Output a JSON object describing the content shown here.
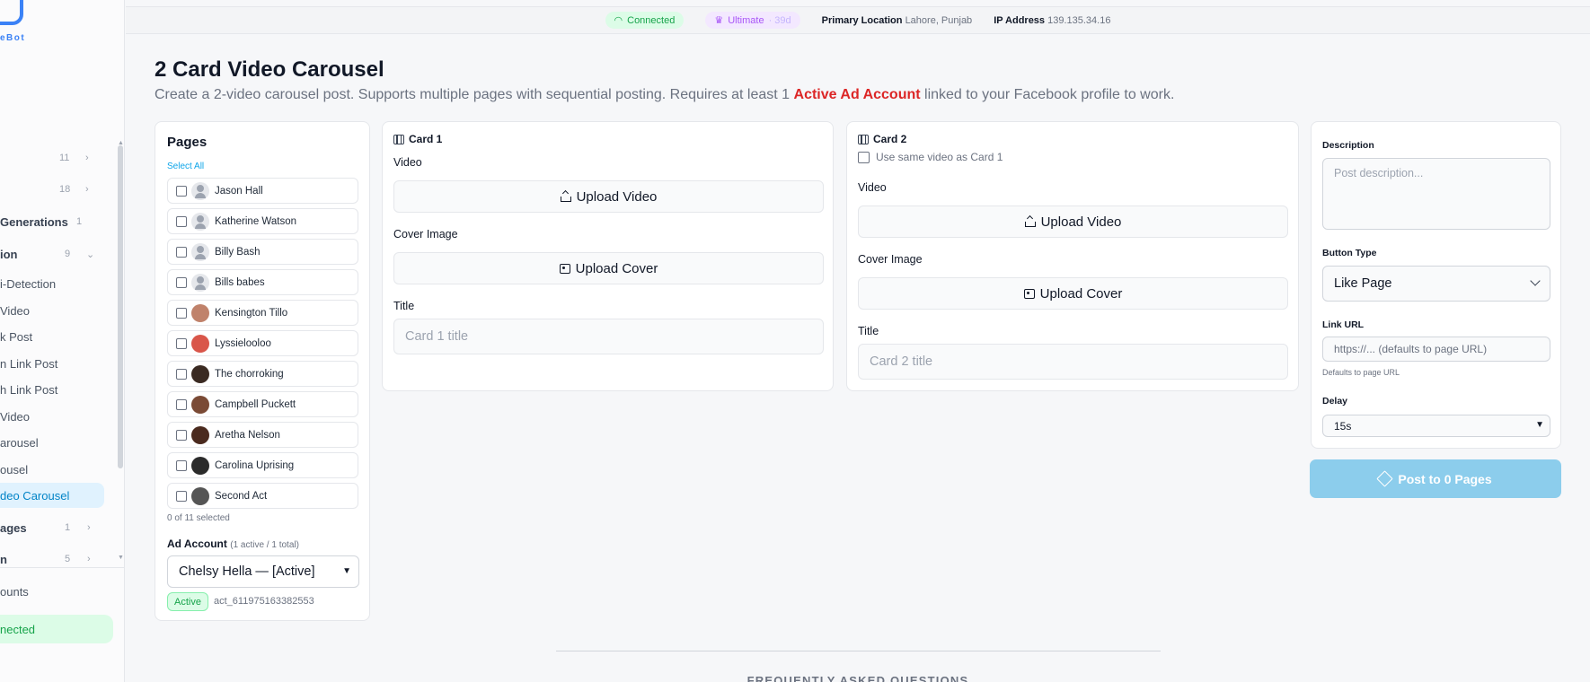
{
  "sidebar": {
    "brand": "eBot",
    "items": [
      {
        "label": "",
        "count": "11",
        "chevron": "›"
      },
      {
        "label": "",
        "count": "18",
        "chevron": "›"
      },
      {
        "label": "Generations",
        "count": "1",
        "chevron": ""
      },
      {
        "label": "ion",
        "count": "9",
        "chevron": "⌄"
      },
      {
        "label": "i-Detection",
        "count": "",
        "chevron": ""
      },
      {
        "label": "Video",
        "count": "",
        "chevron": ""
      },
      {
        "label": "k Post",
        "count": "",
        "chevron": ""
      },
      {
        "label": "n Link Post",
        "count": "",
        "chevron": ""
      },
      {
        "label": "h Link Post",
        "count": "",
        "chevron": ""
      },
      {
        "label": " Video",
        "count": "",
        "chevron": ""
      },
      {
        "label": "arousel",
        "count": "",
        "chevron": ""
      },
      {
        "label": "ousel",
        "count": "",
        "chevron": ""
      },
      {
        "label": "deo Carousel",
        "count": "",
        "chevron": ""
      },
      {
        "label": "ages",
        "count": "1",
        "chevron": "›"
      },
      {
        "label": "n",
        "count": "5",
        "chevron": "›"
      }
    ],
    "accounts_label": "ounts",
    "connected_label": "nected"
  },
  "topbar": {
    "connected": "Connected",
    "plan": "Ultimate",
    "plan_days": "· 39d",
    "location_label": "Primary Location",
    "location_value": "Lahore, Punjab",
    "ip_label": "IP Address",
    "ip_value": "139.135.34.16"
  },
  "header": {
    "title": "2 Card Video Carousel",
    "desc_before": "Create a 2-video carousel post. Supports multiple pages with sequential posting. Requires at least 1 ",
    "desc_highlight": "Active Ad Account",
    "desc_after": " linked to your Facebook profile to work."
  },
  "pages": {
    "title": "Pages",
    "select_all": "Select All",
    "items": [
      {
        "name": "Jason Hall",
        "color": "#e5e7eb"
      },
      {
        "name": "Katherine Watson",
        "color": "#e5e7eb"
      },
      {
        "name": "Billy Bash",
        "color": "#e5e7eb"
      },
      {
        "name": "Bills babes",
        "color": "#e5e7eb"
      },
      {
        "name": "Kensington Tillo",
        "color": "#c0826b"
      },
      {
        "name": "Lyssieloolоо",
        "color": "#d9564a"
      },
      {
        "name": "The chorroking",
        "color": "#3a2a22"
      },
      {
        "name": "Campbell Puckett",
        "color": "#7a4a35"
      },
      {
        "name": "Aretha Nelson",
        "color": "#4a2a1e"
      },
      {
        "name": "Carolina Uprising",
        "color": "#2b2b2b"
      },
      {
        "name": "Second Act",
        "color": "#555555"
      }
    ],
    "selected_text": "0 of 11 selected",
    "ad_account_label": "Ad Account",
    "ad_account_meta": "(1 active / 1 total)",
    "ad_account_value": "Chelsy Hella — [Active]",
    "active_badge": "Active",
    "act_id": "act_611975163382553"
  },
  "card1": {
    "title": "Card 1",
    "video_label": "Video",
    "upload_video": "Upload Video",
    "cover_label": "Cover Image",
    "upload_cover": "Upload Cover",
    "title_label": "Title",
    "title_placeholder": "Card 1 title"
  },
  "card2": {
    "title": "Card 2",
    "same_video": "Use same video as Card 1",
    "video_label": "Video",
    "upload_video": "Upload Video",
    "cover_label": "Cover Image",
    "upload_cover": "Upload Cover",
    "title_label": "Title",
    "title_placeholder": "Card 2 title"
  },
  "settings": {
    "description_label": "Description",
    "description_placeholder": "Post description...",
    "button_type_label": "Button Type",
    "button_type_value": "Like Page",
    "link_url_label": "Link URL",
    "link_url_placeholder": "https://... (defaults to page URL)",
    "link_hint": "Defaults to page URL",
    "delay_label": "Delay",
    "delay_value": "15s"
  },
  "post_button": "Post to 0 Pages",
  "faq_title": "FREQUENTLY ASKED QUESTIONS"
}
